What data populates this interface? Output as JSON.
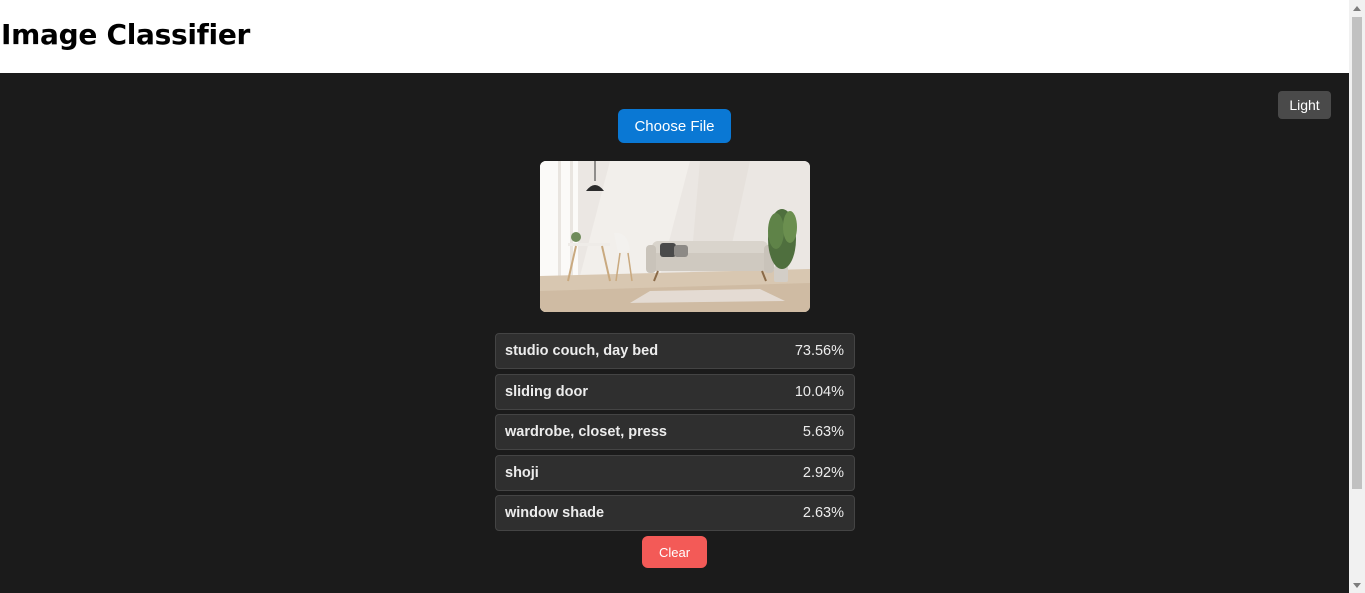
{
  "header": {
    "title": "Image Classifier"
  },
  "controls": {
    "theme_toggle_label": "Light",
    "choose_file_label": "Choose File",
    "clear_label": "Clear"
  },
  "results": [
    {
      "label": "studio couch, day bed",
      "score": "73.56%"
    },
    {
      "label": "sliding door",
      "score": "10.04%"
    },
    {
      "label": "wardrobe, closet, press",
      "score": "5.63%"
    },
    {
      "label": "shoji",
      "score": "2.92%"
    },
    {
      "label": "window shade",
      "score": "2.63%"
    }
  ],
  "colors": {
    "background_dark": "#1b1b1b",
    "primary_button": "#0a78d4",
    "clear_button": "#f35a57",
    "result_row": "#2f2f2f"
  },
  "icons": {
    "scroll_up": "chevron-up-icon",
    "scroll_down": "chevron-down-icon"
  }
}
